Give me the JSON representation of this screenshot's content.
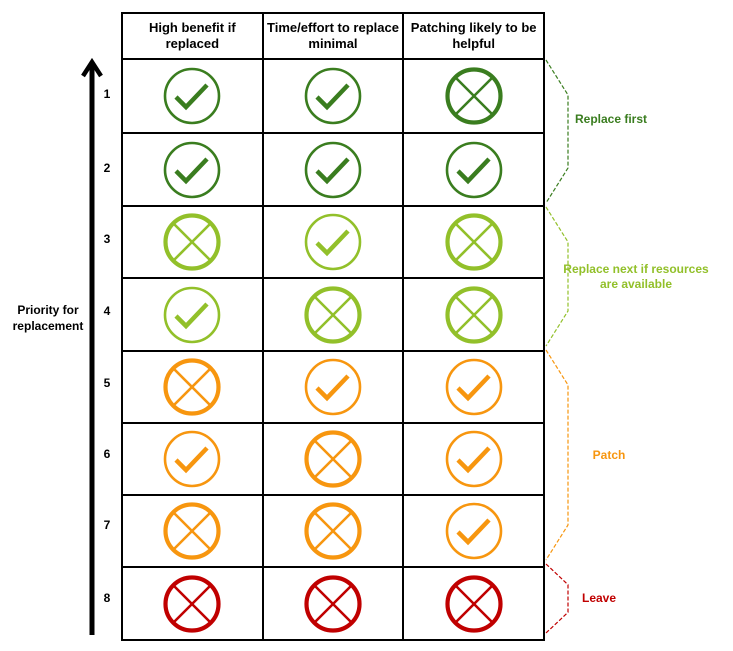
{
  "header": {
    "columns": [
      "High benefit if replaced",
      "Time/effort to replace minimal",
      "Patching likely to be helpful"
    ]
  },
  "axis": {
    "label": "Priority for replacement",
    "direction": "up"
  },
  "colors": {
    "replace_first": "#3a7d1f",
    "replace_next": "#92c02a",
    "patch": "#f7960f",
    "leave": "#c00000"
  },
  "rows": [
    {
      "rank": "1",
      "group": "replace_first",
      "cells": [
        "check",
        "check",
        "cross"
      ]
    },
    {
      "rank": "2",
      "group": "replace_first",
      "cells": [
        "check",
        "check",
        "check"
      ]
    },
    {
      "rank": "3",
      "group": "replace_next",
      "cells": [
        "cross",
        "check",
        "cross"
      ]
    },
    {
      "rank": "4",
      "group": "replace_next",
      "cells": [
        "check",
        "cross",
        "cross"
      ]
    },
    {
      "rank": "5",
      "group": "patch",
      "cells": [
        "cross",
        "check",
        "check"
      ]
    },
    {
      "rank": "6",
      "group": "patch",
      "cells": [
        "check",
        "cross",
        "check"
      ]
    },
    {
      "rank": "7",
      "group": "patch",
      "cells": [
        "cross",
        "cross",
        "check"
      ]
    },
    {
      "rank": "8",
      "group": "leave",
      "cells": [
        "cross",
        "cross",
        "cross"
      ]
    }
  ],
  "groups": [
    {
      "key": "replace_first",
      "label": "Replace first",
      "rows": [
        1,
        2
      ]
    },
    {
      "key": "replace_next",
      "label": "Replace next if resources are available",
      "rows": [
        3,
        4
      ]
    },
    {
      "key": "patch",
      "label": "Patch",
      "rows": [
        5,
        6,
        7
      ]
    },
    {
      "key": "leave",
      "label": "Leave",
      "rows": [
        8
      ]
    }
  ]
}
